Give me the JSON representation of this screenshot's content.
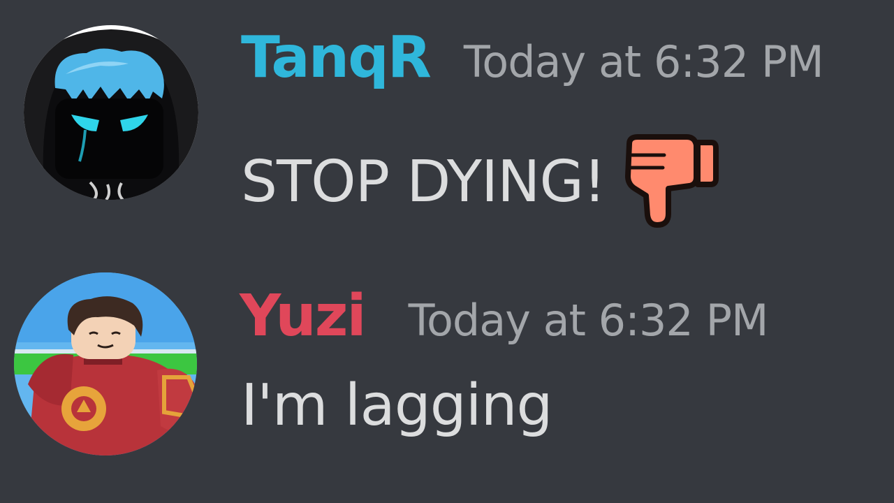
{
  "colors": {
    "background": "#36393f",
    "timestamp": "#a3a6aa",
    "message_text": "#dcddde"
  },
  "messages": [
    {
      "username": "TanqR",
      "username_color": "#2fb7db",
      "timestamp": "Today at 6:32 PM",
      "text": "STOP DYING!",
      "emoji": "thumbs-down-icon",
      "avatar": "roblox-hooded-avatar"
    },
    {
      "username": "Yuzi",
      "username_color": "#e0475a",
      "timestamp": "Today at 6:32 PM",
      "text": "I'm lagging",
      "avatar": "roblox-armored-avatar"
    }
  ]
}
